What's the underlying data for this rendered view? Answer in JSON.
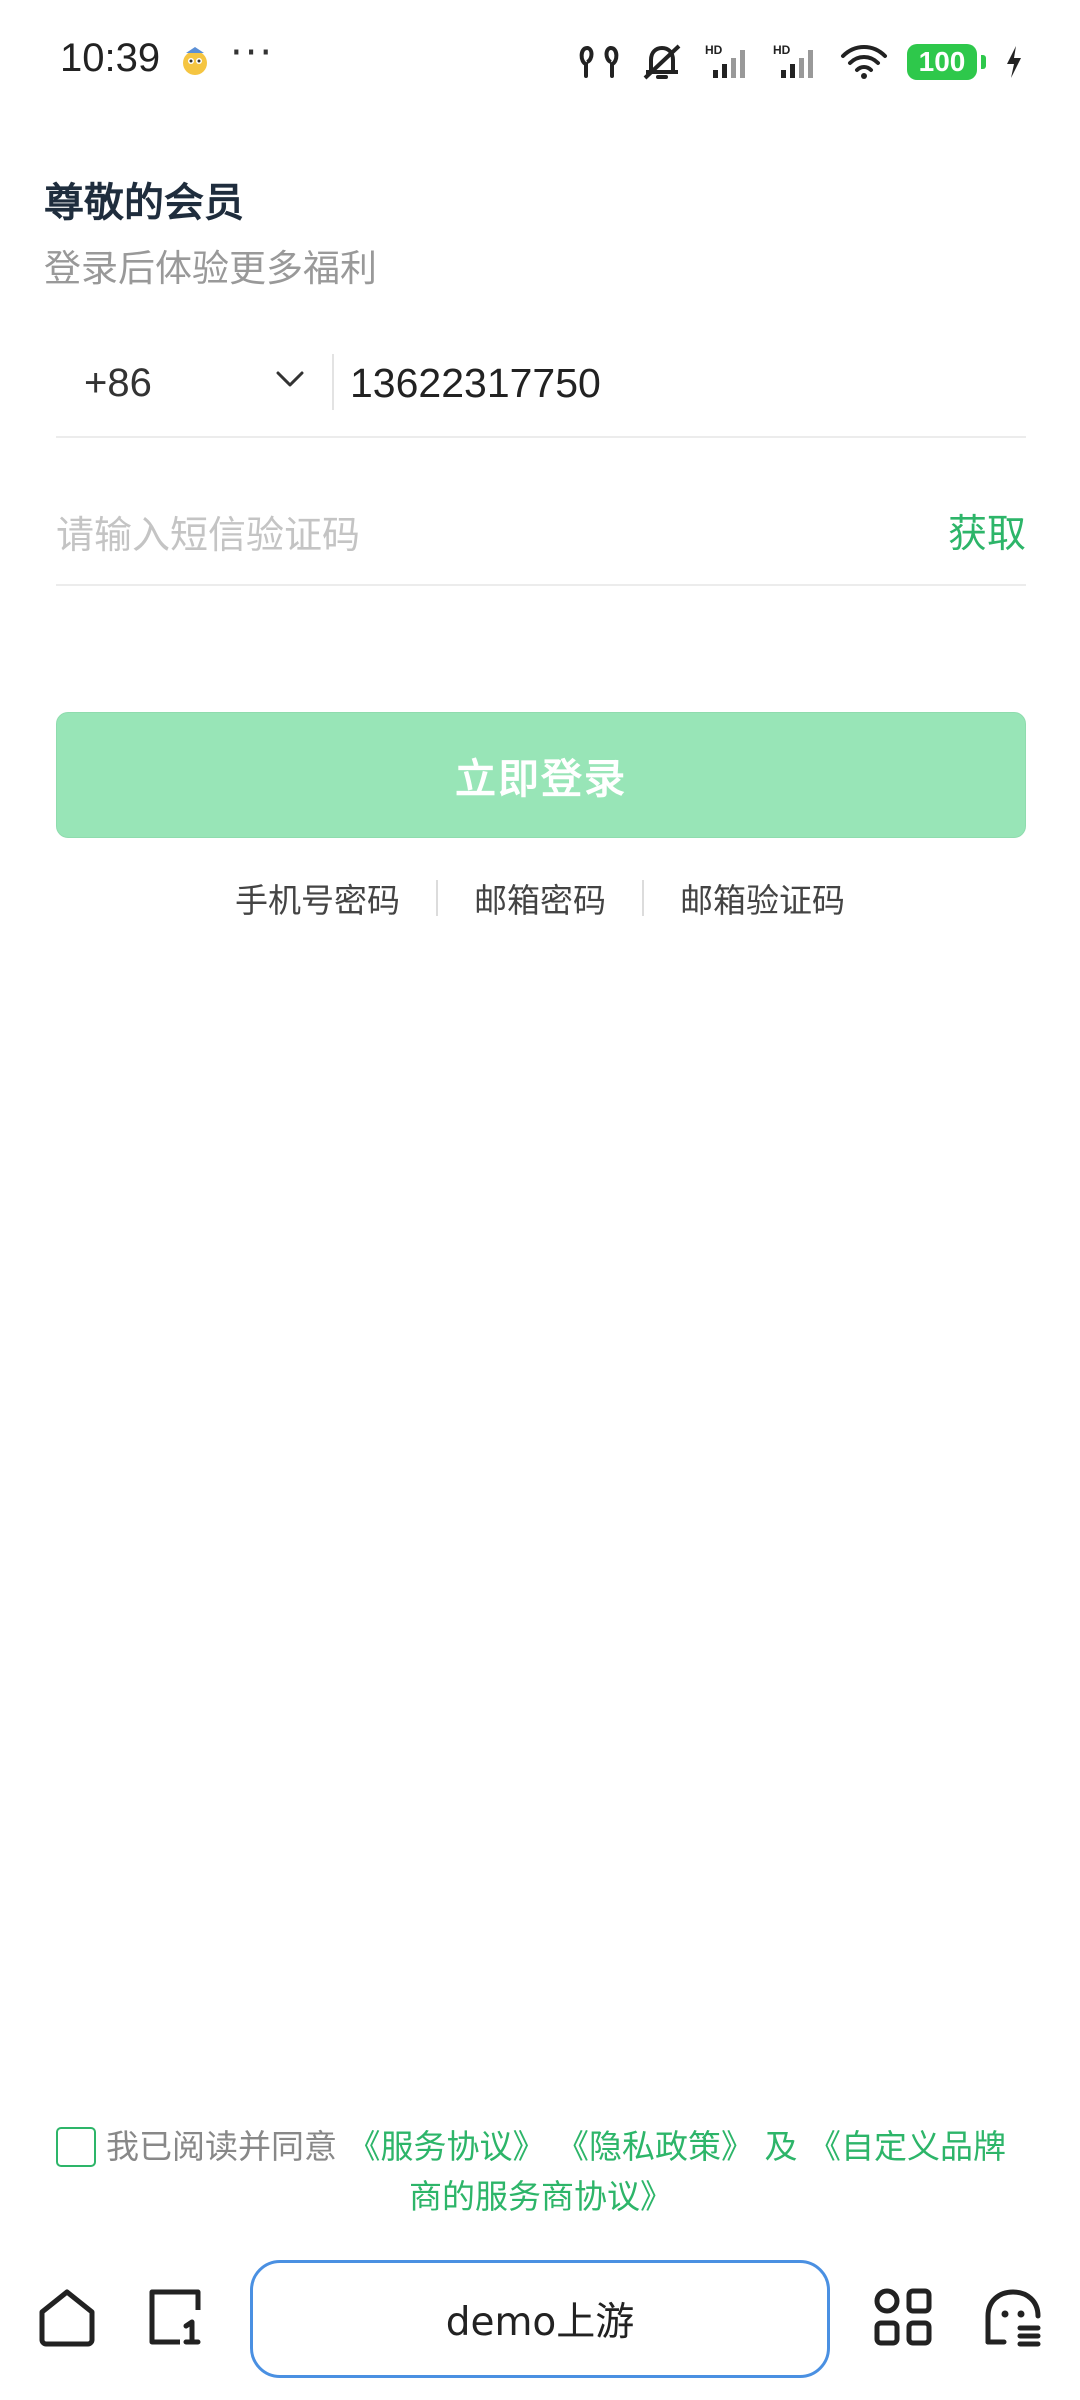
{
  "status_bar": {
    "time": "10:39",
    "dots": "···",
    "battery": "100",
    "icons": [
      "mascot-icon",
      "earbuds-icon",
      "mute-icon",
      "signal-hd-1-icon",
      "signal-hd-2-icon",
      "wifi-icon",
      "battery-icon",
      "charging-icon"
    ],
    "hd_label": "HD"
  },
  "header": {
    "title": "尊敬的会员",
    "subtitle": "登录后体验更多福利"
  },
  "phone": {
    "country_code": "+86",
    "number": "13622317750"
  },
  "sms": {
    "placeholder": "请输入短信验证码",
    "get_code": "获取"
  },
  "login": {
    "label": "立即登录"
  },
  "alt_login": {
    "items": [
      "手机号密码",
      "邮箱密码",
      "邮箱验证码"
    ]
  },
  "agreement": {
    "prefix": "我已阅读并同意",
    "service": "《服务协议》",
    "privacy": "《隐私政策》",
    "and": "及",
    "brand_part1": "《自定义品牌",
    "brand_part2": "商的服务商协议》"
  },
  "bottom_nav": {
    "pill_label": "demo上游"
  },
  "colors": {
    "accent": "#2db569",
    "button_disabled": "#98e5b7",
    "pill_border": "#4a90e2"
  }
}
